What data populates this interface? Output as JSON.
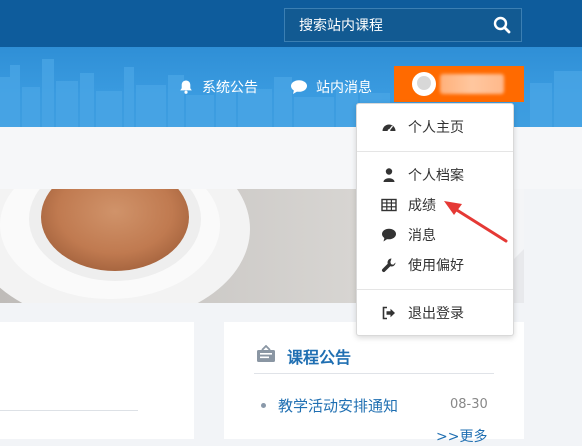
{
  "search": {
    "placeholder": "搜索站内课程"
  },
  "nav": {
    "announcements": "系统公告",
    "messages": "站内消息"
  },
  "dropdown": {
    "items": [
      {
        "label": "个人主页",
        "icon": "dashboard-icon"
      },
      {
        "label": "个人档案",
        "icon": "user-icon"
      },
      {
        "label": "成绩",
        "icon": "table-icon"
      },
      {
        "label": "消息",
        "icon": "chat-icon"
      },
      {
        "label": "使用偏好",
        "icon": "wrench-icon"
      },
      {
        "label": "退出登录",
        "icon": "logout-icon"
      }
    ]
  },
  "notices": {
    "title": "课程公告",
    "items": [
      {
        "title": "教学活动安排通知",
        "date": "08-30"
      }
    ],
    "more": ">>更多"
  },
  "colors": {
    "topbar": "#0e5c9c",
    "banner": "#3a9be0",
    "accent": "#ff6a00",
    "link": "#1f6fb2",
    "annotation_arrow": "#e53935"
  }
}
